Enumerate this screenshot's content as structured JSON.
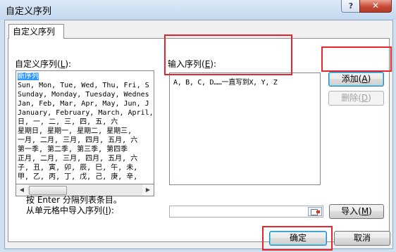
{
  "window": {
    "title": "自定义序列",
    "help_glyph": "?",
    "close_glyph": "✕"
  },
  "tab": {
    "label": "自定义序列"
  },
  "left": {
    "label": "自定义序列(",
    "label_key": "L",
    "label_end": "):",
    "items": [
      "新序列",
      "Sun, Mon, Tue, Wed, Thu, Fri, S",
      "Sunday, Monday, Tuesday, Wednes",
      "Jan, Feb, Mar, Apr, May, Jun, J",
      "January, February, March, April,",
      "日, 一, 二, 三, 四, 五, 六",
      "星期日, 星期一, 星期二, 星期三,",
      "一月, 二月, 三月, 四月, 五月, 六",
      "第一季, 第二季, 第三季, 第四季",
      "正月, 二月, 三月, 四月, 五月, 六",
      "子, 丑, 寅, 卯, 辰, 巳, 午, 未,",
      "甲, 乙, 丙, 丁, 戊, 己, 庚, 辛,"
    ],
    "selected_index": 0
  },
  "entries": {
    "label": "输入序列(",
    "label_key": "E",
    "label_end": "):",
    "value": "A, B, C, D……一直写到X, Y, Z"
  },
  "buttons": {
    "add": {
      "label": "添加(",
      "key": "A",
      "end": ")"
    },
    "delete": {
      "label": "删除(",
      "key": "D",
      "end": ")"
    },
    "import": {
      "label": "导入(",
      "key": "M",
      "end": ")"
    },
    "ok": "确定",
    "cancel": "取消"
  },
  "hint": "按 Enter 分隔列表条目。",
  "import_label": {
    "label": "从单元格中导入序列(",
    "key": "I",
    "end": "):"
  },
  "import_value": "",
  "colors": {
    "highlight_box": "#e8242c",
    "selection": "#3399ff",
    "titlebar": "#c3d8ee",
    "close_button": "#c74a37"
  },
  "icons": [
    "help-icon",
    "close-icon",
    "collapse-dialog-icon",
    "scroll-left-icon",
    "scroll-right-icon"
  ]
}
